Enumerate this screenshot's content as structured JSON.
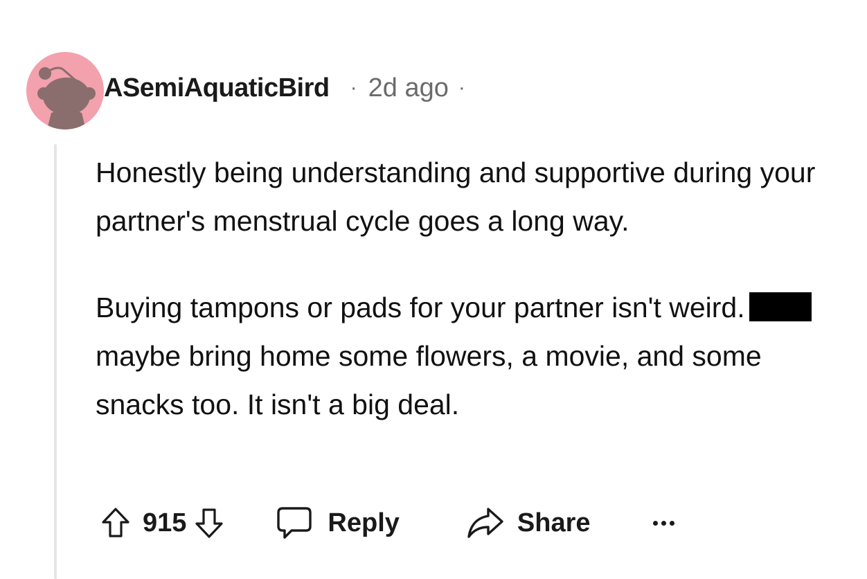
{
  "comment": {
    "author": "ASemiAquaticBird",
    "separator": "·",
    "timestamp": "2d ago",
    "body": {
      "paragraph_1": "Honestly being understanding and supportive during your partner's menstrual cycle goes a long way.",
      "paragraph_2_before_redaction": "Buying tampons or pads for your partner isn't weird.",
      "paragraph_2_after_redaction": "maybe bring home some flowers, a movie, and some snacks too. It isn't a big deal."
    },
    "actions": {
      "score": "915",
      "reply_label": "Reply",
      "share_label": "Share"
    }
  },
  "colors": {
    "avatar_background": "#f2a1ad",
    "avatar_figure": "#8a6d6d",
    "meta_text": "#6b6b6b",
    "thread_line": "#e6e6e6"
  },
  "icons": [
    "snoo-avatar-icon",
    "upvote-icon",
    "downvote-icon",
    "comment-bubble-icon",
    "share-arrow-icon",
    "more-options-icon"
  ]
}
